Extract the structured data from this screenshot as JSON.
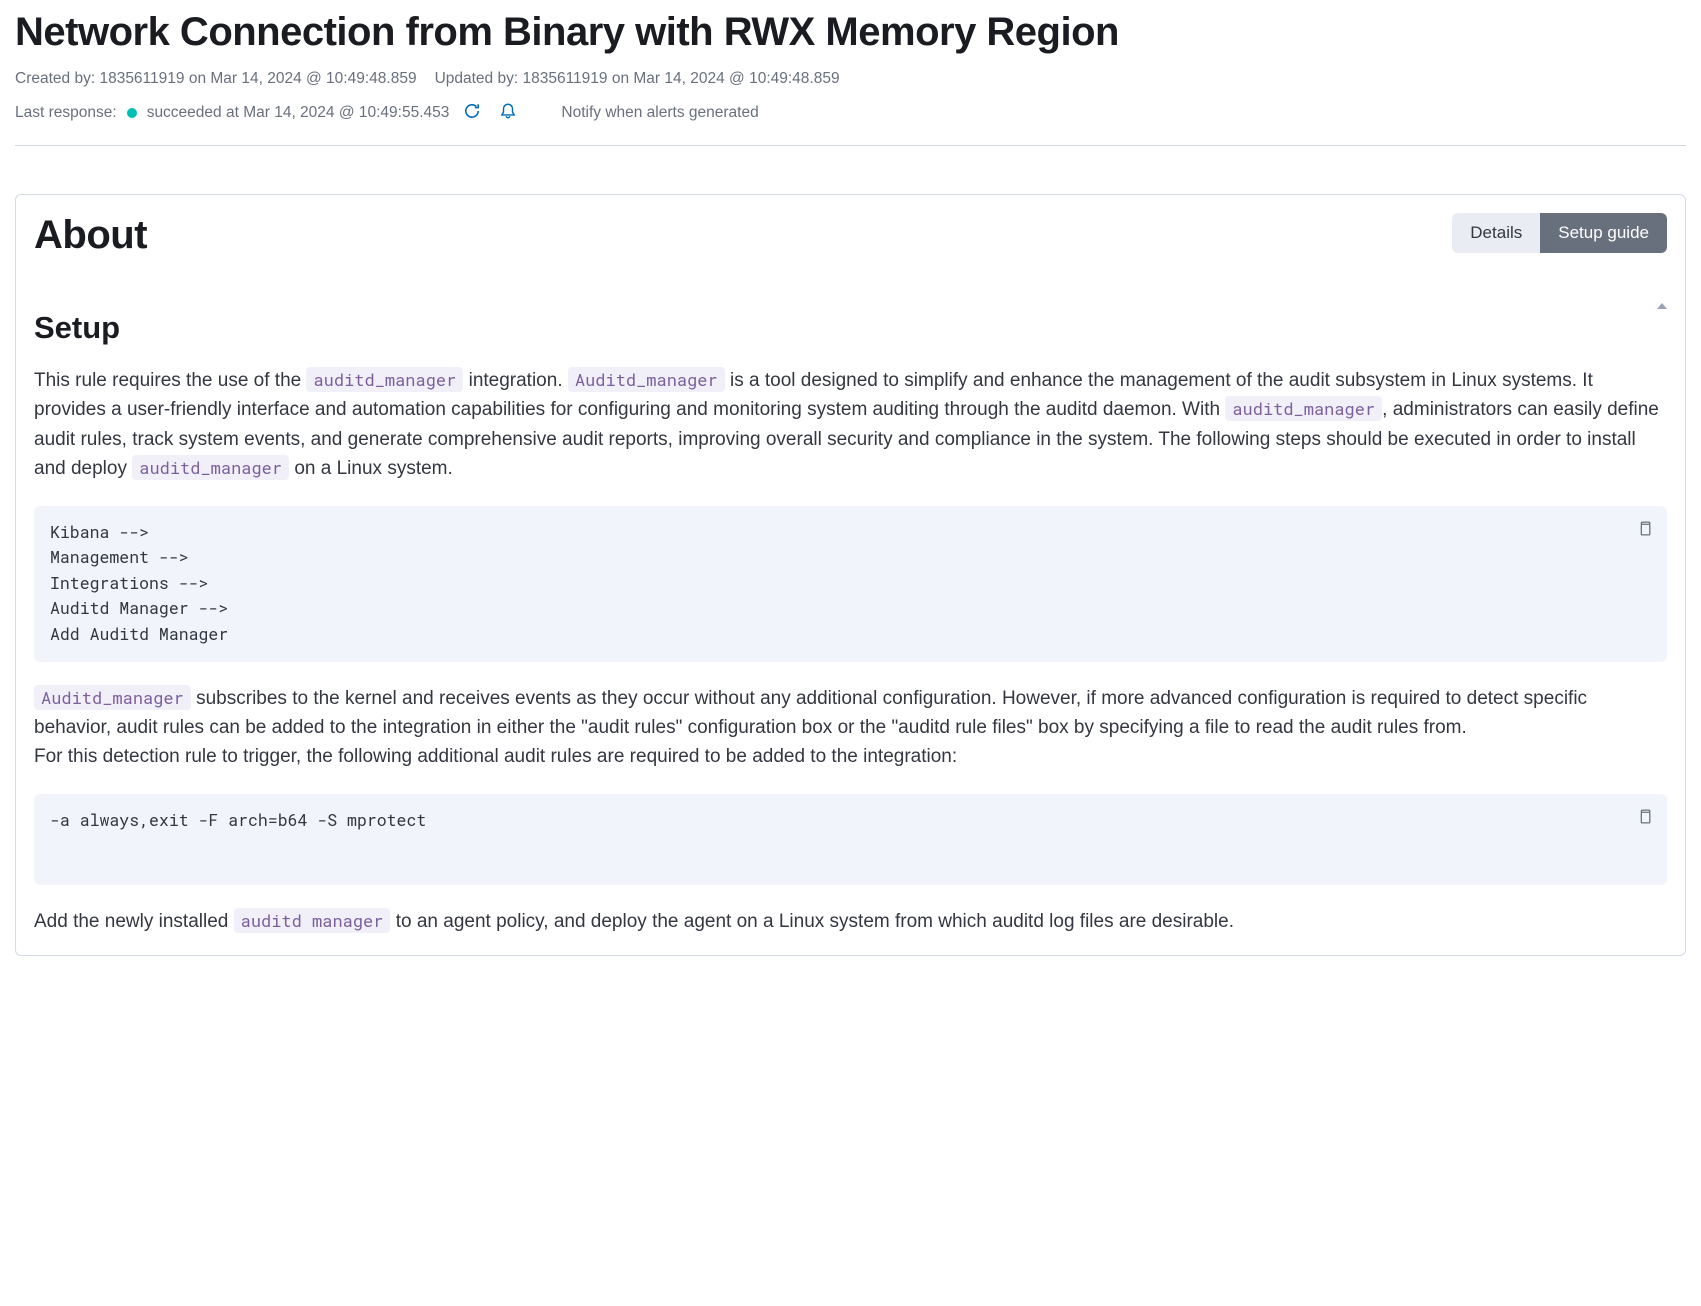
{
  "header": {
    "title": "Network Connection from Binary with RWX Memory Region",
    "created_label": "Created by:",
    "created_by": "1835611919",
    "created_on": "on Mar 14, 2024 @ 10:49:48.859",
    "updated_label": "Updated by:",
    "updated_by": "1835611919",
    "updated_on": "on Mar 14, 2024 @ 10:49:48.859",
    "last_response_label": "Last response:",
    "status_text": "succeeded at Mar 14, 2024 @ 10:49:55.453",
    "notify_label": "Notify when alerts generated"
  },
  "panel": {
    "title": "About",
    "tabs": {
      "details": "Details",
      "setup": "Setup guide"
    },
    "section_title": "Setup",
    "para1": {
      "t1": "This rule requires the use of the ",
      "c1": "auditd_manager",
      "t2": " integration. ",
      "c2": "Auditd_manager",
      "t3": " is a tool designed to simplify and enhance the management of the audit subsystem in Linux systems. It provides a user-friendly interface and automation capabilities for configuring and monitoring system auditing through the auditd daemon. With ",
      "c3": "auditd_manager",
      "t4": ", administrators can easily define audit rules, track system events, and generate comprehensive audit reports, improving overall security and compliance in the system. The following steps should be executed in order to install and deploy ",
      "c4": "auditd_manager",
      "t5": " on a Linux system."
    },
    "code1": "Kibana -->\nManagement -->\nIntegrations -->\nAuditd Manager -->\nAdd Auditd Manager",
    "para2": {
      "c1": "Auditd_manager",
      "t1": " subscribes to the kernel and receives events as they occur without any additional configuration. However, if more advanced configuration is required to detect specific behavior, audit rules can be added to the integration in either the \"audit rules\" configuration box or the \"auditd rule files\" box by specifying a file to read the audit rules from.",
      "t2": "For this detection rule to trigger, the following additional audit rules are required to be added to the integration:"
    },
    "code2": "-a always,exit -F arch=b64 -S mprotect",
    "para3": {
      "t1": "Add the newly installed ",
      "c1": "auditd manager",
      "t2": " to an agent policy, and deploy the agent on a Linux system from which auditd log files are desirable."
    }
  }
}
